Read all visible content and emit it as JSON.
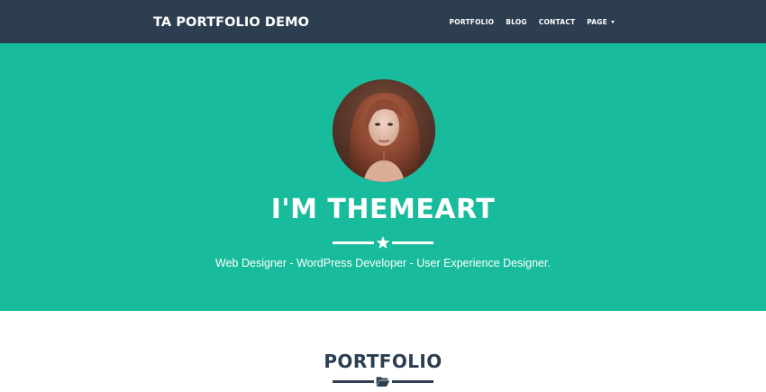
{
  "navbar": {
    "brand": "TA PORTFOLIO DEMO",
    "items": [
      {
        "label": "PORTFOLIO"
      },
      {
        "label": "BLOG"
      },
      {
        "label": "CONTACT"
      },
      {
        "label": "PAGE",
        "has_dropdown": true
      }
    ]
  },
  "hero": {
    "title": "I'M THEMEART",
    "divider_icon": "star-icon",
    "subtitle": "Web Designer - WordPress Developer - User Experience Designer."
  },
  "portfolio": {
    "title": "PORTFOLIO",
    "divider_icon": "folder-open-icon"
  },
  "colors": {
    "navbar_bg": "#2c3e50",
    "hero_bg": "#18bc9c",
    "text_light": "#ffffff",
    "text_dark": "#2c3e50"
  }
}
